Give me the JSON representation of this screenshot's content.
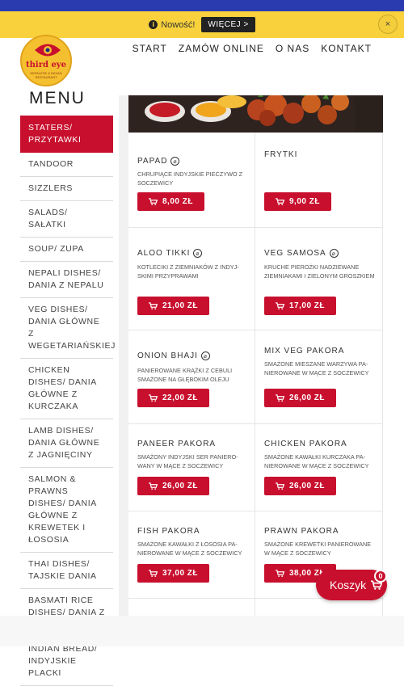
{
  "notice": {
    "text": "Nowość!",
    "more_label": "WIĘCEJ >",
    "close_label": "×"
  },
  "logo": {
    "name": "third eye",
    "sub": "NEPALESE & INDIAN RESTAURANT"
  },
  "nav": {
    "items": [
      "START",
      "ZAMÓW ONLINE",
      "O NAS",
      "KONTAKT"
    ]
  },
  "menu": {
    "title": "MENU",
    "categories": [
      "STATERS/ PRZYTAWKI",
      "TANDOOR",
      "SIZZLERS",
      "SALADS/ SAŁATKI",
      "SOUP/ ZUPA",
      "NEPALI DISHES/ DANIA Z NEPALU",
      "VEG DISHES/ DANIA GŁÓWNE Z WEGETARIAŃSKIEJ",
      "CHICKEN DISHES/ DANIA GŁÓWNE Z KURCZAKA",
      "LAMB DISHES/ DANIA GŁÓWNE Z JAGNIĘCINY",
      "SALMON & PRAWNS DISHES/ DANIA GŁÓWNE Z KREWETEK I ŁOSOSIA",
      "THAI DISHES/ TAJSKIE DANIA",
      "BASMATI RICE DISHES/ DANIA Z RYŻEM BASMATI",
      "INDIAN BREAD/ INDYJSKIE PLACKI"
    ]
  },
  "items": [
    {
      "name": "PAPAD",
      "veg": true,
      "desc": "CHRUPIĄCE INDYJSKIE PIECZYWO Z SOCZEWICY",
      "price": "8,00 ZŁ"
    },
    {
      "name": "FRYTKI",
      "veg": false,
      "desc": "",
      "price": "9,00 ZŁ"
    },
    {
      "name": "ALOO TIKKI",
      "veg": true,
      "desc": "KOTLECIKI Z ZIEMNIAKÓW Z INDYJ-SKIMI PRZYPRAWAMI",
      "price": "21,00 ZŁ"
    },
    {
      "name": "VEG SAMOSA",
      "veg": true,
      "desc": "KRUCHE PIEROŻKI NADZIEWANE ZIEMNIAKAMI I ZIELONYM GROSZKIEM",
      "price": "17,00 ZŁ"
    },
    {
      "name": "ONION BHAJI",
      "veg": true,
      "desc": "PANIEROWANE KRĄŻKI Z CEBULI SMAŻONE NA GŁĘBOKIM OLEJU",
      "price": "22,00 ZŁ"
    },
    {
      "name": "MIX VEG PAKORA",
      "veg": false,
      "desc": "SMAŻONE MIESZANE WARZYWA PA-NIEROWANE W MĄCE Z SOCZEWICY",
      "price": "26,00 ZŁ"
    },
    {
      "name": "PANEER PAKORA",
      "veg": false,
      "desc": "SMAŻONY INDYJSKI SER PANIERO-WANY W MĄCE Z SOCZEWICY",
      "price": "26,00 ZŁ"
    },
    {
      "name": "CHICKEN PAKORA",
      "veg": false,
      "desc": "SMAŻONE KAWAŁKI KURCZAKA PA-NIEROWANE W MĄCE Z SOCZEWICY",
      "price": "26,00 ZŁ"
    },
    {
      "name": "FISH PAKORA",
      "veg": false,
      "desc": "SMAŻONE KAWAŁKI Z ŁOSOSIA PA-NIEROWANE W MĄCE Z SOCZEWICY",
      "price": "37,00 ZŁ"
    },
    {
      "name": "PRAWN PAKORA",
      "veg": false,
      "desc": "SMAŻONE KREWETKI PANIEROWANE W MĄCE Z SOCZEWICY",
      "price": "38,00 ZŁ"
    }
  ],
  "basket": {
    "label": "Koszyk",
    "count": "0"
  },
  "colors": {
    "accent": "#c8102e",
    "notice_bg": "#f8d13c",
    "top_strip": "#2a3bb0"
  }
}
